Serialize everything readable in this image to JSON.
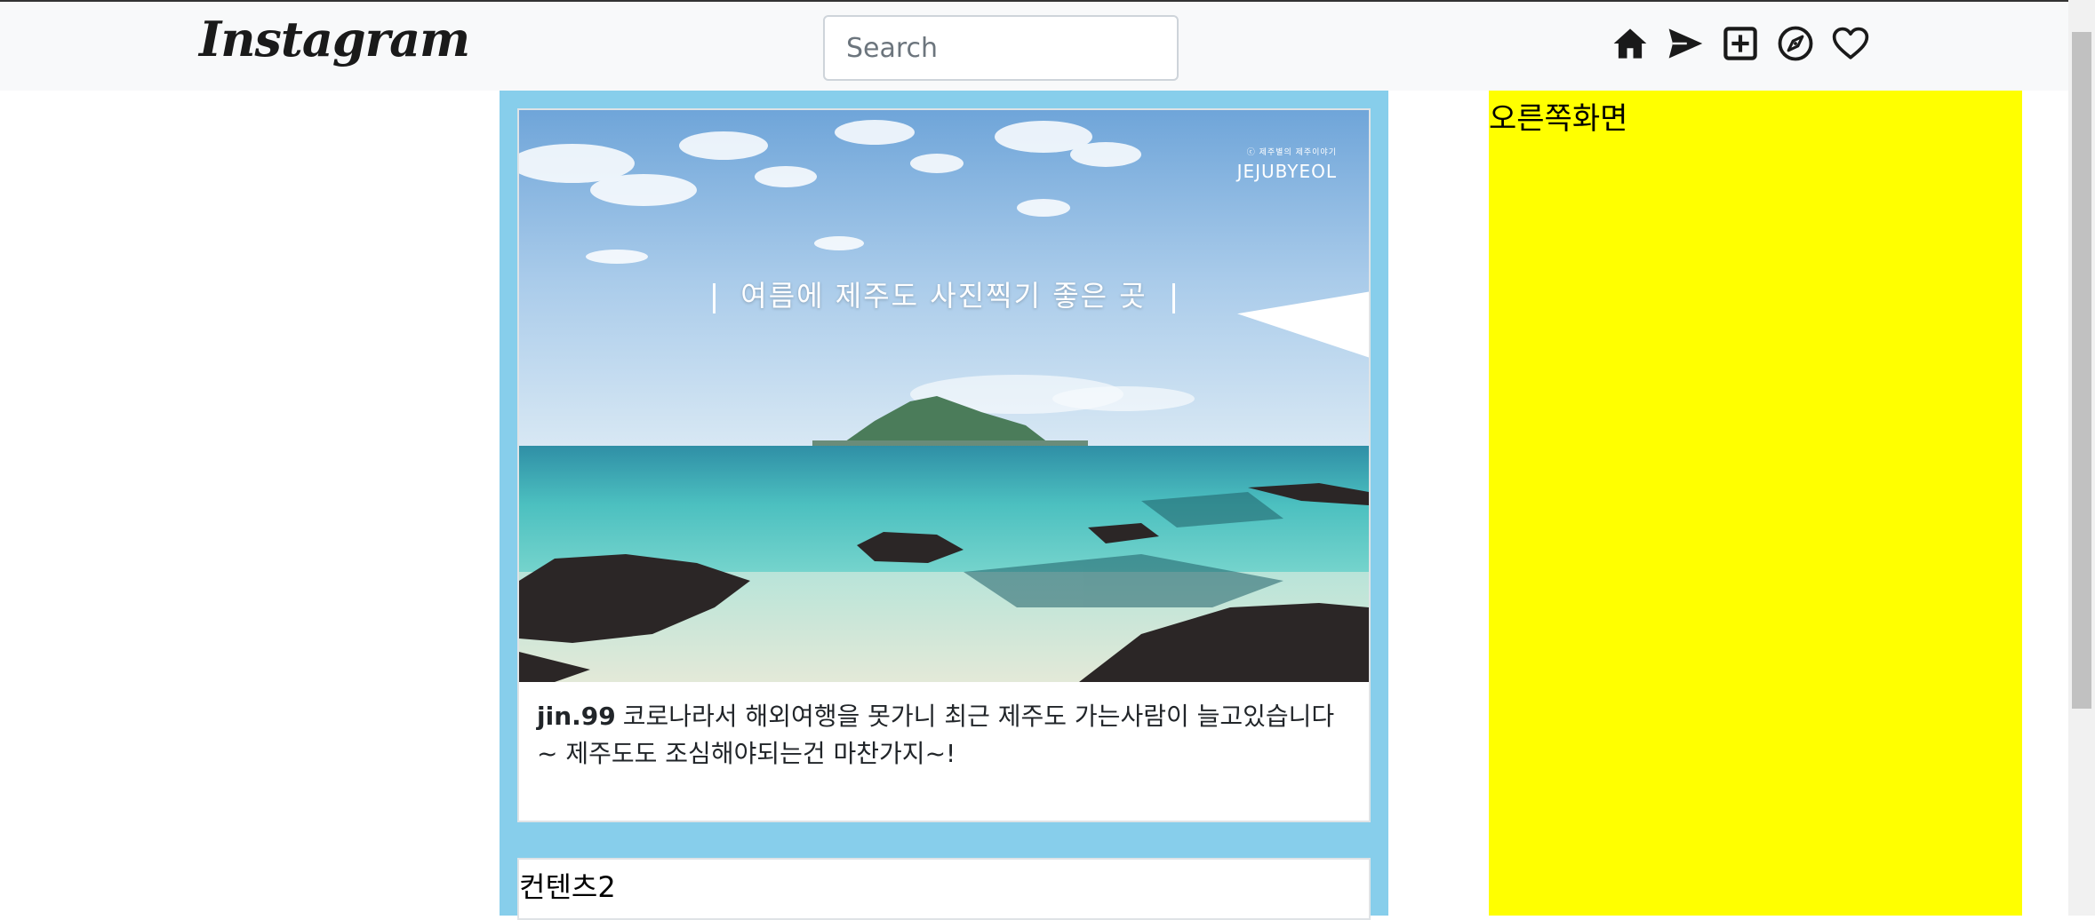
{
  "navbar": {
    "logo": "Instagram",
    "search_placeholder": "Search",
    "icons": [
      "home-icon",
      "send-icon",
      "add-post-icon",
      "explore-icon",
      "heart-icon"
    ]
  },
  "feed": {
    "posts": [
      {
        "image_title": "여름에 제주도 사진찍기 좋은 곳",
        "image_watermark_small": "ⓒ 제주별의 제주이야기",
        "image_watermark": "JEJUBYEOL",
        "username": "jin.99",
        "caption": "코로나라서 해외여행을 못가니 최근 제주도 가는사람이 늘고있습니다~ 제주도도 조심해야되는건 마찬가지~!"
      },
      {
        "text": "컨텐츠2"
      }
    ]
  },
  "right_panel": {
    "label": "오른쪽화면"
  },
  "colors": {
    "nav_bg": "#f8f9fa",
    "feed_bg": "#87ceeb",
    "right_bg": "#ffff00"
  }
}
